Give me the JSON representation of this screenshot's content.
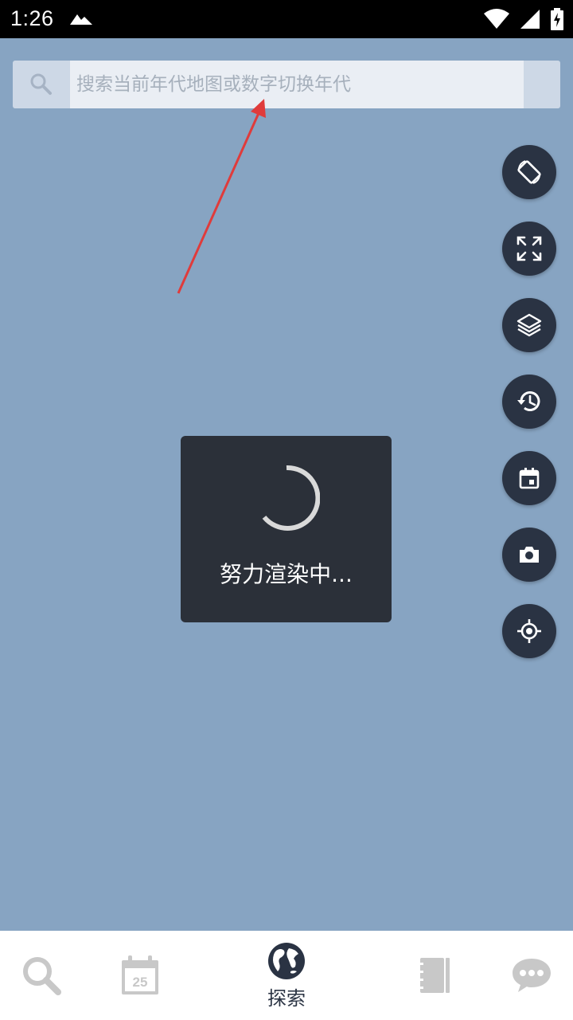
{
  "status_bar": {
    "time": "1:26",
    "icons": [
      "notification-mountain-icon",
      "wifi-icon",
      "signal-icon",
      "battery-charging-icon"
    ]
  },
  "search": {
    "placeholder": "搜索当前年代地图或数字切换年代",
    "value": ""
  },
  "map_controls": [
    {
      "name": "rotate-screen-icon"
    },
    {
      "name": "fullscreen-icon"
    },
    {
      "name": "layers-icon"
    },
    {
      "name": "history-icon"
    },
    {
      "name": "calendar-icon"
    },
    {
      "name": "camera-icon"
    },
    {
      "name": "my-location-icon"
    }
  ],
  "loading": {
    "text": "努力渲染中..."
  },
  "bottom_nav": {
    "items": [
      {
        "icon": "search-icon",
        "label": ""
      },
      {
        "icon": "calendar-icon",
        "badge": "25",
        "label": ""
      },
      {
        "icon": "globe-icon",
        "label": "探索",
        "active": true
      },
      {
        "icon": "notebook-icon",
        "label": ""
      },
      {
        "icon": "chat-icon",
        "label": ""
      }
    ]
  },
  "colors": {
    "map_bg": "#87a4c2",
    "fab_bg": "#2a3343",
    "annotation_arrow": "#e03b3b",
    "nav_inactive": "#c8c8c8"
  }
}
